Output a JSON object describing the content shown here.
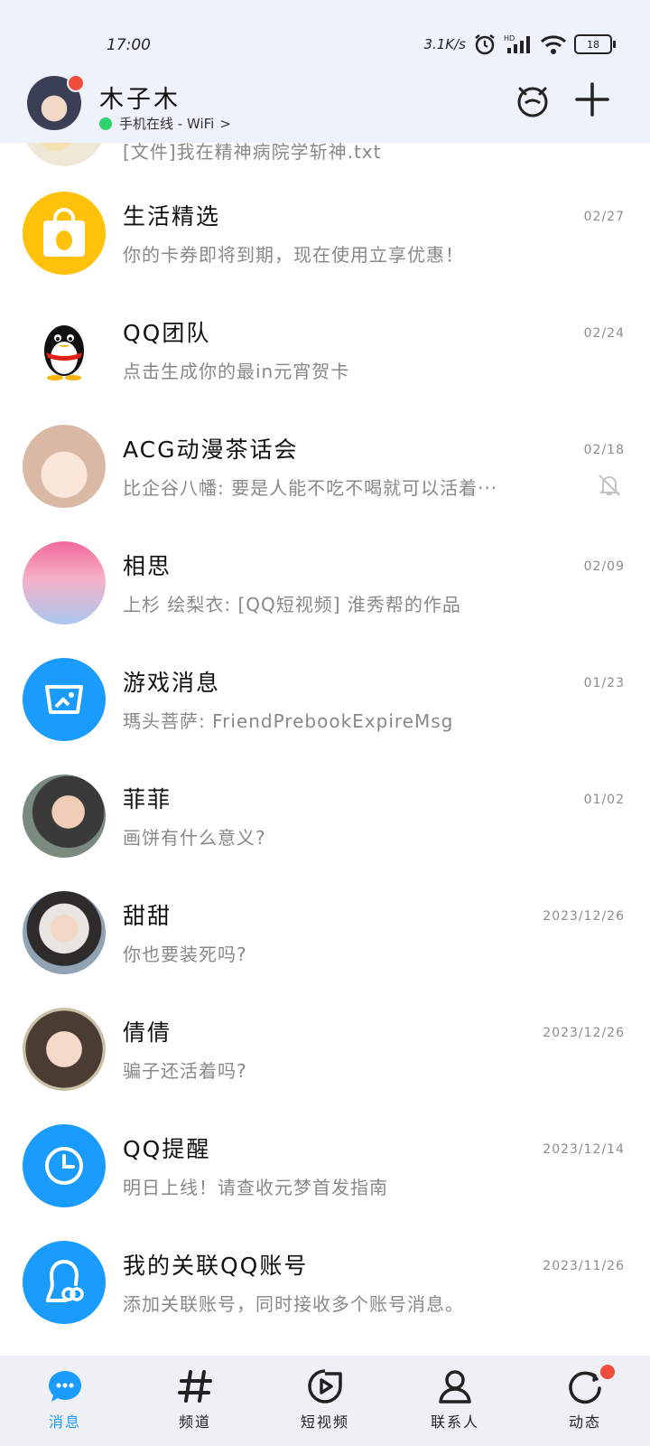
{
  "status": {
    "time": "17:00",
    "speed": "3.1K/s",
    "battery": "18"
  },
  "header": {
    "name": "木子木",
    "online": "手机在线 - WiFi",
    "online_chevron": ">"
  },
  "conversations": [
    {
      "title": "",
      "preview": "[文件]我在精神病院学斩神.txt",
      "time": ""
    },
    {
      "title": "生活精选",
      "preview": "你的卡券即将到期，现在使用立享优惠！",
      "time": "02/27"
    },
    {
      "title": "QQ团队",
      "preview": "点击生成你的最in元宵贺卡",
      "time": "02/24"
    },
    {
      "title": "ACG动漫茶话会",
      "preview": "比企谷八幡: 要是人能不吃不喝就可以活着···",
      "time": "02/18"
    },
    {
      "title": "相思",
      "preview": "上杉 绘梨衣: [QQ短视频] 淮秀帮的作品",
      "time": "02/09"
    },
    {
      "title": "游戏消息",
      "preview": "瑪头菩萨: FriendPrebookExpireMsg",
      "time": "01/23"
    },
    {
      "title": "菲菲",
      "preview": "画饼有什么意义?",
      "time": "01/02"
    },
    {
      "title": "甜甜",
      "preview": "你也要装死吗?",
      "time": "2023/12/26"
    },
    {
      "title": "倩倩",
      "preview": "骗子还活着吗?",
      "time": "2023/12/26"
    },
    {
      "title": "QQ提醒",
      "preview": "明日上线！请查收元梦首发指南",
      "time": "2023/12/14"
    },
    {
      "title": "我的关联QQ账号",
      "preview": "添加关联账号，同时接收多个账号消息。",
      "time": "2023/11/26"
    }
  ],
  "nav": [
    {
      "label": "消息",
      "icon": "message-icon",
      "active": true
    },
    {
      "label": "频道",
      "icon": "hash-icon"
    },
    {
      "label": "短视频",
      "icon": "video-icon"
    },
    {
      "label": "联系人",
      "icon": "contact-icon"
    },
    {
      "label": "动态",
      "icon": "activity-icon"
    }
  ],
  "colors": {
    "accent": "#1a9cff",
    "badge": "#f24c3d",
    "online": "#2fd36e",
    "header_bg": "#eef2fb"
  }
}
